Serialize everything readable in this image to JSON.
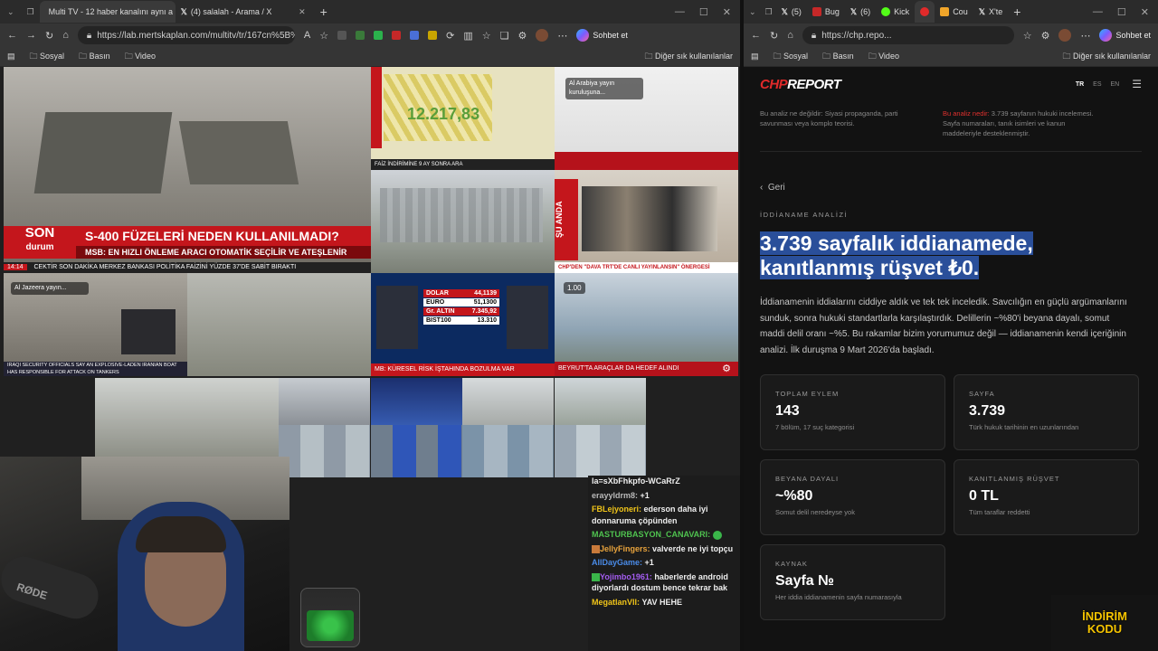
{
  "left_browser": {
    "tabs": [
      {
        "label": "Multi TV - 12 haber kanalını aynı a",
        "active": true
      },
      {
        "label": "(4) salalah - Arama / X",
        "active": false
      }
    ],
    "url": "https://lab.mertskaplan.com/multitv/tr/167cn%5B%5...",
    "chat_button": "Sohbet et",
    "bookmarks": [
      "Sosyal",
      "Basın",
      "Video"
    ],
    "other_bookmarks": "Diğer sık kullanılanlar"
  },
  "right_browser": {
    "tabs": [
      {
        "label": "(5)"
      },
      {
        "label": "Bug"
      },
      {
        "label": "(6)"
      },
      {
        "label": "Kick"
      },
      {
        "label": "Cou"
      },
      {
        "label": "X'te"
      }
    ],
    "url": "https://chp.repo...",
    "chat_button": "Sohbet et",
    "bookmarks": [
      "Sosyal",
      "Basın",
      "Video"
    ],
    "other_bookmarks": "Diğer sık kullanılanlar"
  },
  "tv": {
    "tile1_brand_top": "SON",
    "tile1_brand_bottom": "durum",
    "tile1_headline": "S-400 FÜZELERİ NEDEN KULLANILMADI?",
    "tile1_sub": "MSB: EN HIZLI ÖNLEME ARACI OTOMATİK SEÇİLİR VE ATEŞLENİR",
    "tile1_clock": "14:14",
    "tile1_ticker": "CEKTİR   SON DAKİKA   MERKEZ BANKASI POLİTİKA FAİZİNİ YÜZDE 37'DE SABİT BIRAKTI",
    "tile2_number": "12.217,83",
    "tile2_ticker": "FAİZ İNDİRİMİNE 9 AY SONRA ARA",
    "tile3_label": "Al Arabiya yayın kuruluşuna...",
    "tile5_badge": "ŞU ANDA",
    "tile5_ticker": "CHP'DEN \"DAVA TRT'DE CANLI YAYINLANSIN\" ÖNERGESİ",
    "tile6_label": "Al Jazeera yayın...",
    "tile6_ticker": "IRAQI SECURITY OFFICIALS SAY AN EXPLOSIVE-LADEN IRANIAN BOAT HAS RESPONSIBLE FOR ATTACK ON TANKERS",
    "markets": [
      {
        "name": "DOLAR",
        "value": "44,1139"
      },
      {
        "name": "EURO",
        "value": "51,1300"
      },
      {
        "name": "Gr. ALTIN",
        "value": "7.345,92"
      },
      {
        "name": "BIST100",
        "value": "13.310"
      }
    ],
    "tile8_ticker": "MB: KÜRESEL RİSK İŞTAHINDA BOZULMA VAR",
    "tile9_version": "1.00",
    "tile9_ticker": "BEYRUT'TA ARAÇLAR DA HEDEF ALINDI"
  },
  "chat": [
    {
      "user": "",
      "text": "la=sXbFhkpfo-WCaRrZ",
      "color": "#dddddd"
    },
    {
      "user": "erayyldrm8:",
      "text": "+1",
      "color": "#b9b9b9"
    },
    {
      "user": "FBLejyoneri:",
      "text": "ederson daha iyi donnaruma çöpünden",
      "color": "#f0c419"
    },
    {
      "user": "MASTURBASYON_CANAVARI:",
      "text": "",
      "color": "#4fc34f"
    },
    {
      "user": "JellyFingers:",
      "text": "valverde ne iyi topçu",
      "color": "#e8a33c"
    },
    {
      "user": "AllDayGame:",
      "text": "+1",
      "color": "#4a8be8"
    },
    {
      "user": "Yojimbo1961:",
      "text": "haberlerde android diyorlardı dostum bence tekrar bak",
      "color": "#a35cf0"
    },
    {
      "user": "MegatlanVII:",
      "text": "YAV HEHE",
      "color": "#f0c419"
    }
  ],
  "webcam_mic_brand": "RØDE",
  "chp": {
    "logo_a": "CHP",
    "logo_b": "REPORT",
    "langs": [
      "TR",
      "ES",
      "EN"
    ],
    "disclaimer_left": "Bu analiz ne değildir: Siyasi propaganda, parti savunması veya komplo teorisi.",
    "disclaimer_right_label": "Bu analiz nedir:",
    "disclaimer_right": "3.739 sayfanın hukuki incelemesi. Sayfa numaraları, tanık isimleri ve kanun maddeleriyle desteklenmiştir.",
    "back": "Geri",
    "eyebrow": "İDDİANAME ANALİZİ",
    "headline_line1": "3.739 sayfalık iddianamede,",
    "headline_line2": "kanıtlanmış rüşvet ₺0.",
    "lede": "İddianamenin iddialarını ciddiye aldık ve tek tek inceledik. Savcılığın en güçlü argümanlarını sunduk, sonra hukuki standartlarla karşılaştırdık. Delillerin ~%80'i beyana dayalı, somut maddi delil oranı ~%5. Bu rakamlar bizim yorumumuz değil — iddianamenin kendi içeriğinin analizi. İlk duruşma 9 Mart 2026'da başladı.",
    "cards": [
      {
        "key": "TOPLAM EYLEM",
        "value": "143",
        "sub": "7 bölüm, 17 suç kategorisi"
      },
      {
        "key": "SAYFA",
        "value": "3.739",
        "sub": "Türk hukuk tarihinin en uzunlarından"
      },
      {
        "key": "BEYANA DAYALI",
        "value": "~%80",
        "sub": "Somut delil neredeyse yok"
      },
      {
        "key": "KANITLANMIŞ RÜŞVET",
        "value": "0 TL",
        "sub": "Tüm taraflar reddetti"
      },
      {
        "key": "KAYNAK",
        "value": "Sayfa №",
        "sub": "Her iddia iddianamenin sayfa numarasıyla"
      }
    ]
  },
  "promo": {
    "line1": "İNDİRİM",
    "line2": "KODU"
  },
  "colors": {
    "accent_red": "#e02a2a",
    "highlight_blue": "#2a4f9a",
    "promo_yellow": "#f5c400"
  }
}
